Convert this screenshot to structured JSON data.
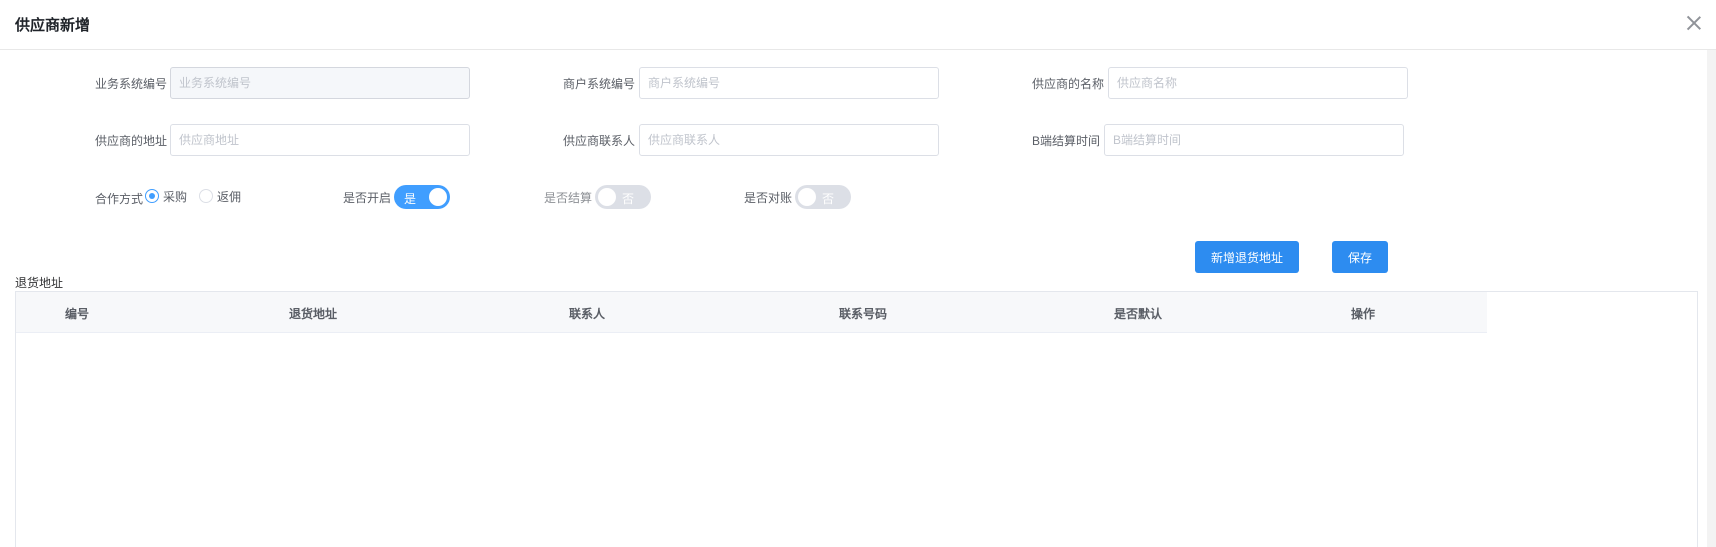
{
  "dialog": {
    "title": "供应商新增"
  },
  "form": {
    "business_code": {
      "label": "业务系统编号",
      "placeholder": "业务系统编号",
      "value": ""
    },
    "merchant_code": {
      "label": "商户系统编号",
      "placeholder": "商户系统编号",
      "value": ""
    },
    "supplier_name": {
      "label": "供应商的名称",
      "placeholder": "供应商名称",
      "value": ""
    },
    "supplier_address": {
      "label": "供应商的地址",
      "placeholder": "供应商地址",
      "value": ""
    },
    "supplier_contact": {
      "label": "供应商联系人",
      "placeholder": "供应商联系人",
      "value": ""
    },
    "settle_time": {
      "label": "B端结算时间",
      "placeholder": "B端结算时间",
      "value": ""
    },
    "coop_mode": {
      "label": "合作方式",
      "options": [
        "采购",
        "返佣"
      ],
      "selected": "采购"
    },
    "is_open": {
      "label": "是否开启",
      "state_text": "是",
      "on": true
    },
    "is_settle": {
      "label": "是否结算",
      "state_text": "否",
      "on": false
    },
    "is_reconcile": {
      "label": "是否对账",
      "state_text": "否",
      "on": false
    }
  },
  "buttons": {
    "add_return_address": "新增退货地址",
    "save": "保存"
  },
  "return_address": {
    "title": "退货地址",
    "columns": [
      "编号",
      "退货地址",
      "联系人",
      "联系号码",
      "是否默认",
      "操作"
    ],
    "rows": []
  },
  "colors": {
    "primary": "#409eff",
    "button": "#2d8cf0"
  },
  "icons": {
    "close": "close-icon"
  }
}
